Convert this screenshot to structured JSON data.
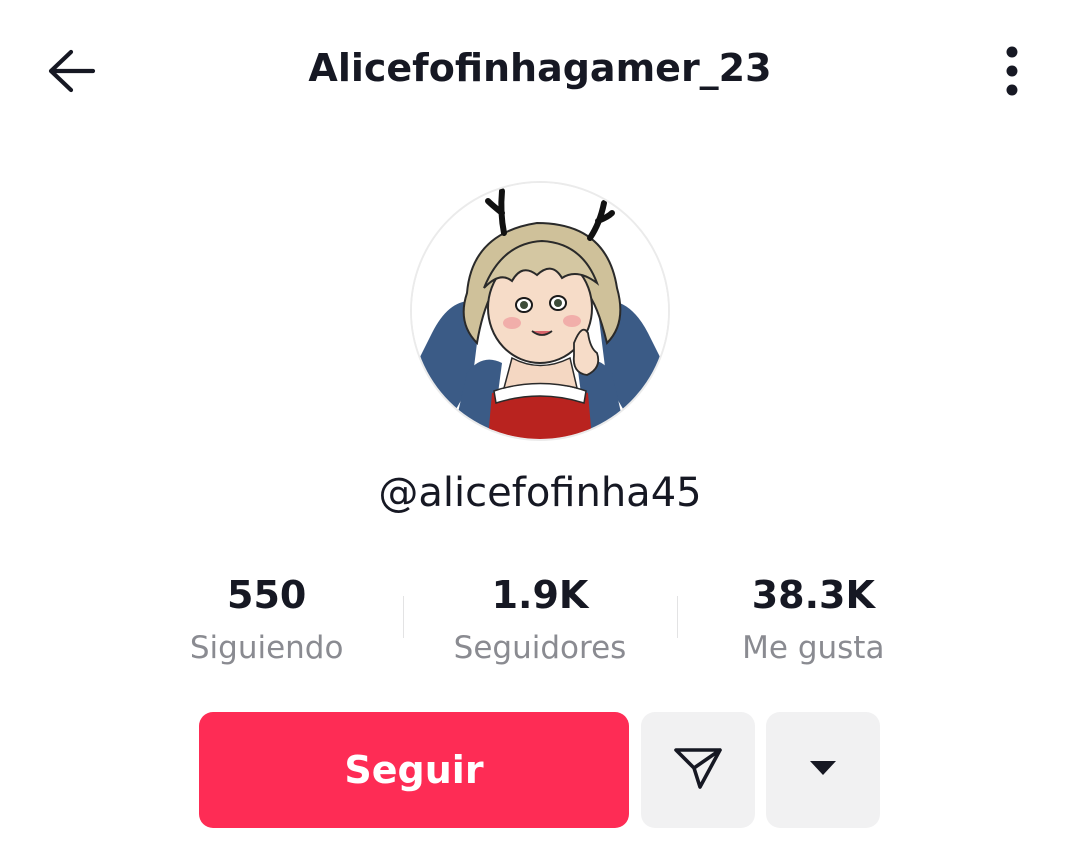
{
  "header": {
    "back_icon": "arrow-left-icon",
    "title": "Alicefofinhagamer_23",
    "more_icon": "more-vertical-icon"
  },
  "profile": {
    "avatar": "profile-avatar-illustration",
    "handle": "@alicefofinha45"
  },
  "stats": [
    {
      "value": "550",
      "label": "Siguiendo"
    },
    {
      "value": "1.9K",
      "label": "Seguidores"
    },
    {
      "value": "38.3K",
      "label": "Me gusta"
    }
  ],
  "actions": {
    "follow_label": "Seguir",
    "message_icon": "send-icon",
    "dropdown_icon": "caret-down-icon"
  },
  "colors": {
    "accent": "#fe2c55",
    "text_primary": "#161823",
    "text_secondary": "#8a8b91",
    "button_secondary_bg": "#f1f1f2"
  }
}
